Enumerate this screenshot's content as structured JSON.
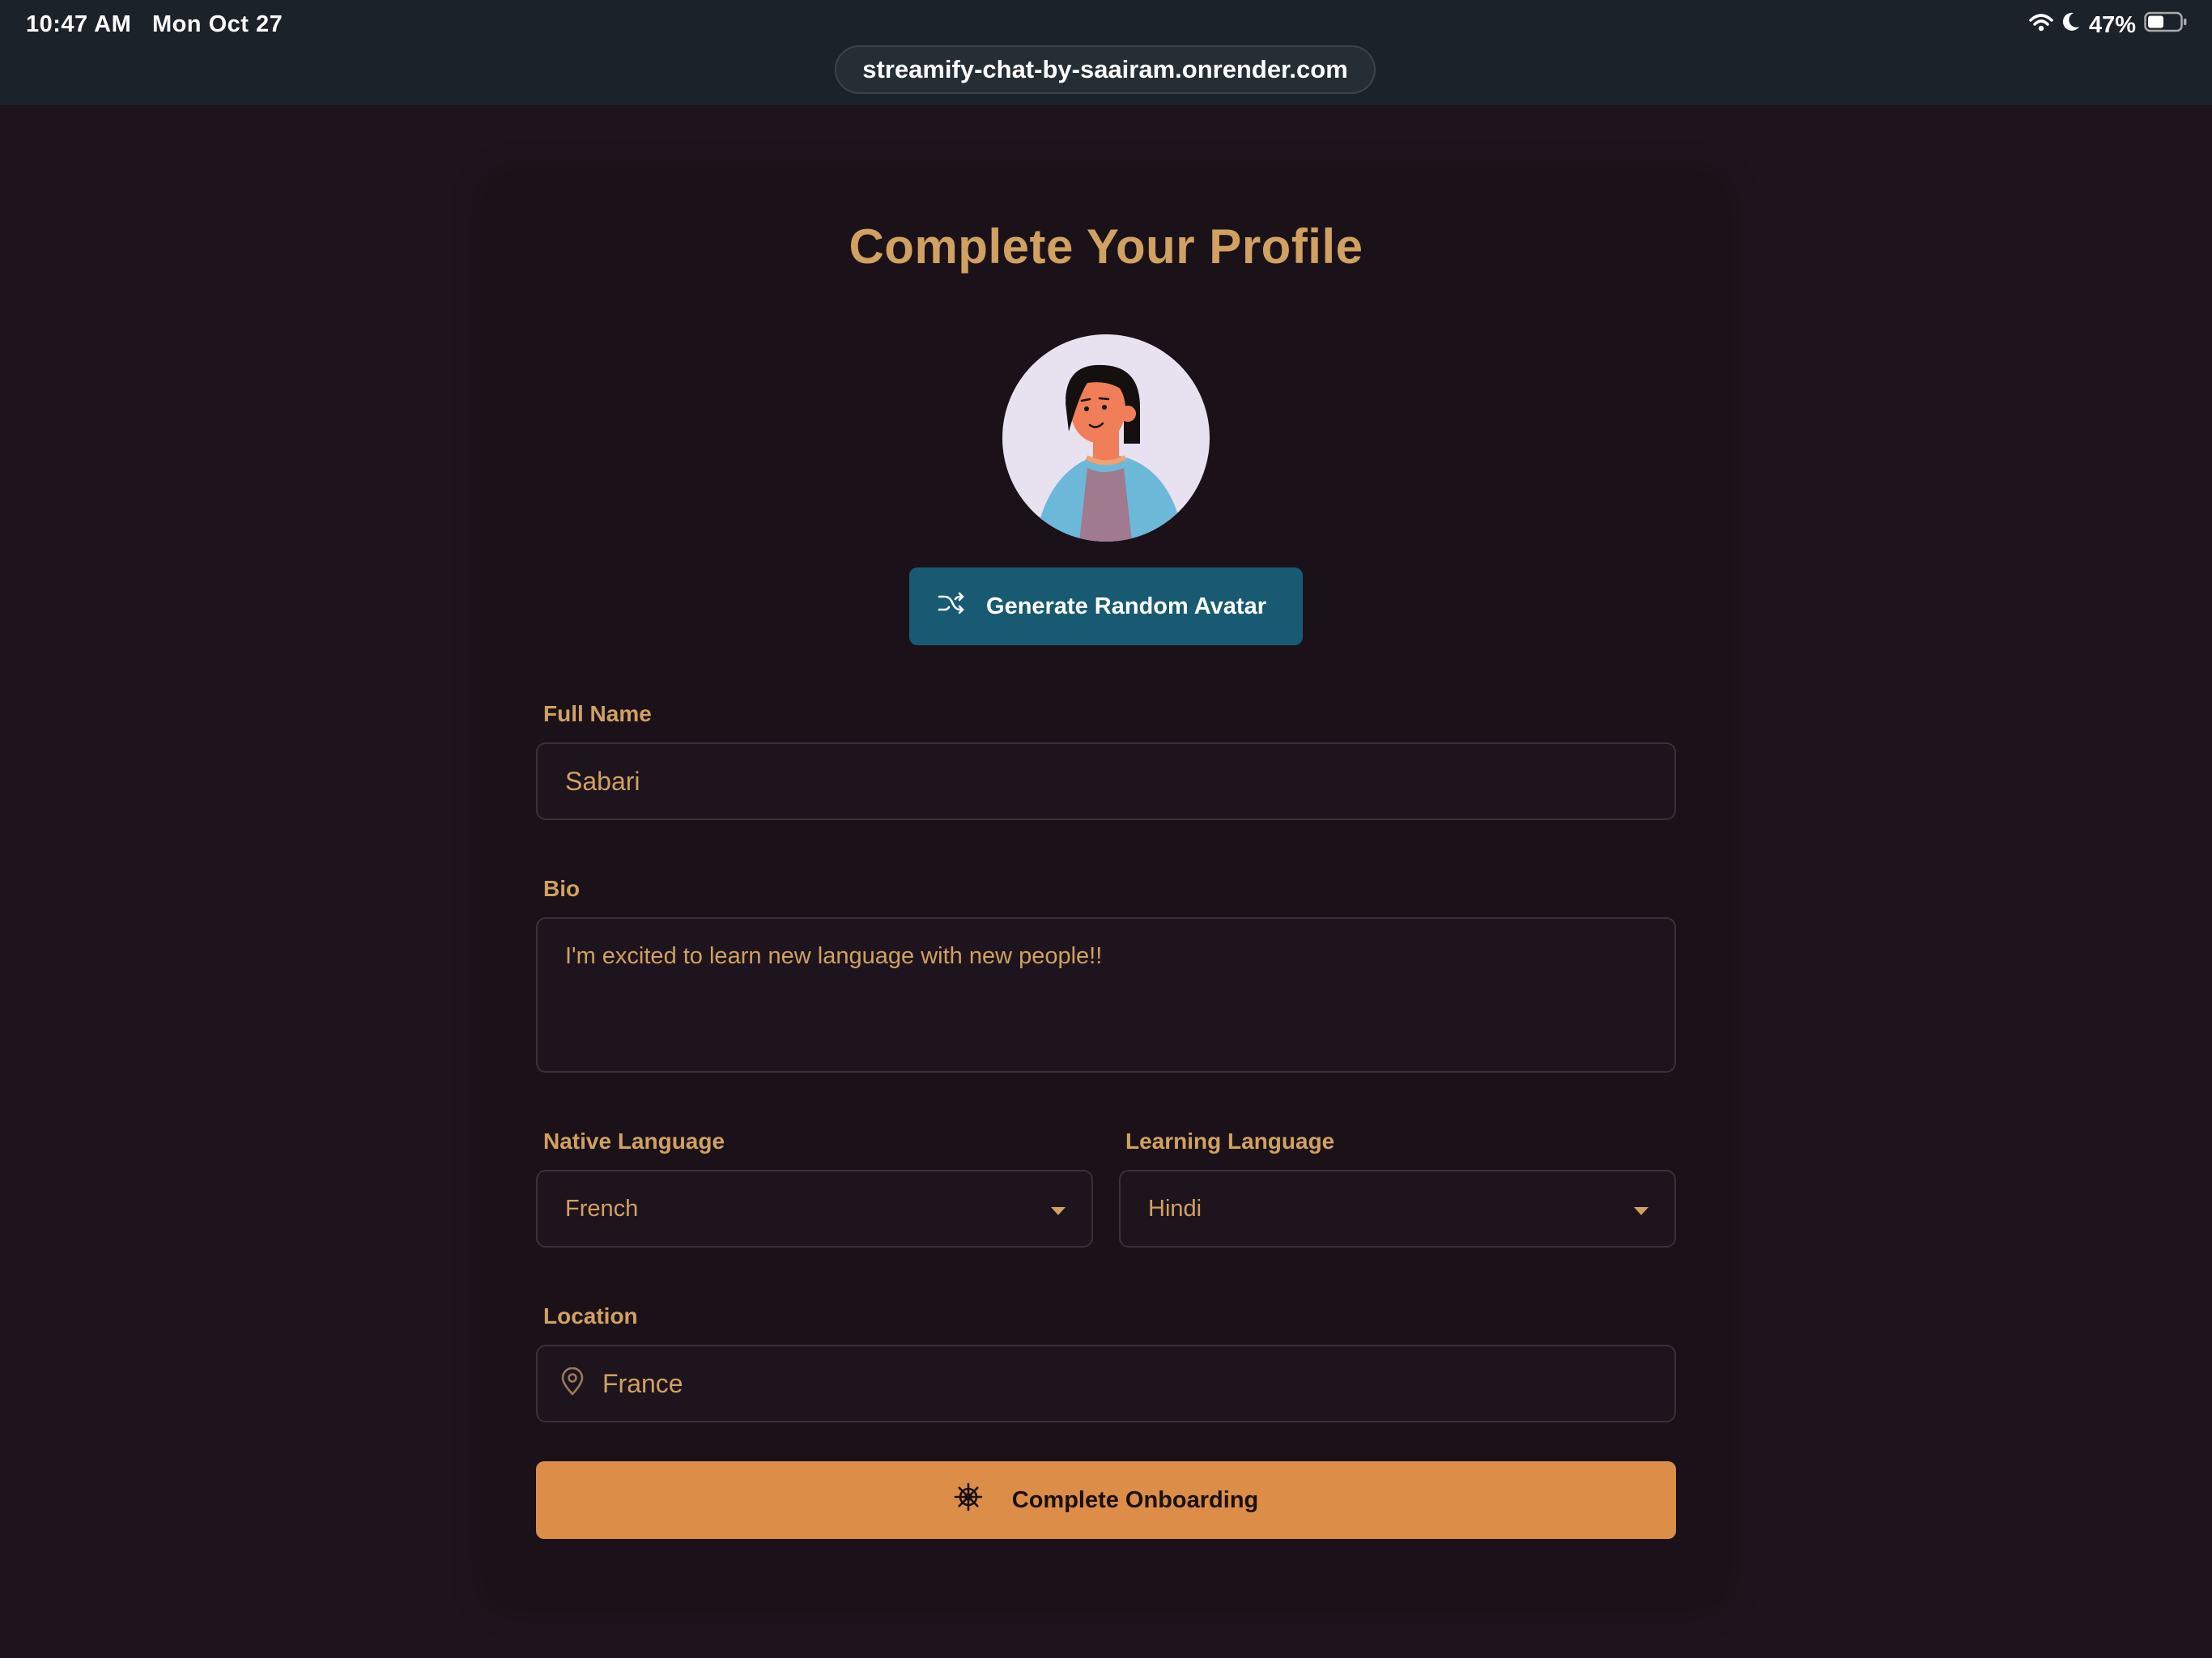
{
  "status_bar": {
    "time": "10:47 AM",
    "date": "Mon Oct 27",
    "battery": "47%",
    "icons": [
      "wifi-icon",
      "moon-icon",
      "battery-icon"
    ]
  },
  "browser": {
    "url": "streamify-chat-by-saairam.onrender.com"
  },
  "form": {
    "title": "Complete Your Profile",
    "generate_avatar_label": "Generate Random Avatar",
    "full_name": {
      "label": "Full Name",
      "value": "Sabari"
    },
    "bio": {
      "label": "Bio",
      "value": "I'm excited to learn new language with new people!!"
    },
    "native_language": {
      "label": "Native Language",
      "value": "French"
    },
    "learning_language": {
      "label": "Learning Language",
      "value": "Hindi"
    },
    "location": {
      "label": "Location",
      "value": "France"
    },
    "submit_label": "Complete Onboarding"
  },
  "colors": {
    "background": "#1e141d",
    "card": "#1b1219",
    "accent_text": "#d0a160",
    "secondary_button": "#175a72",
    "primary_button": "#dc8d48"
  }
}
